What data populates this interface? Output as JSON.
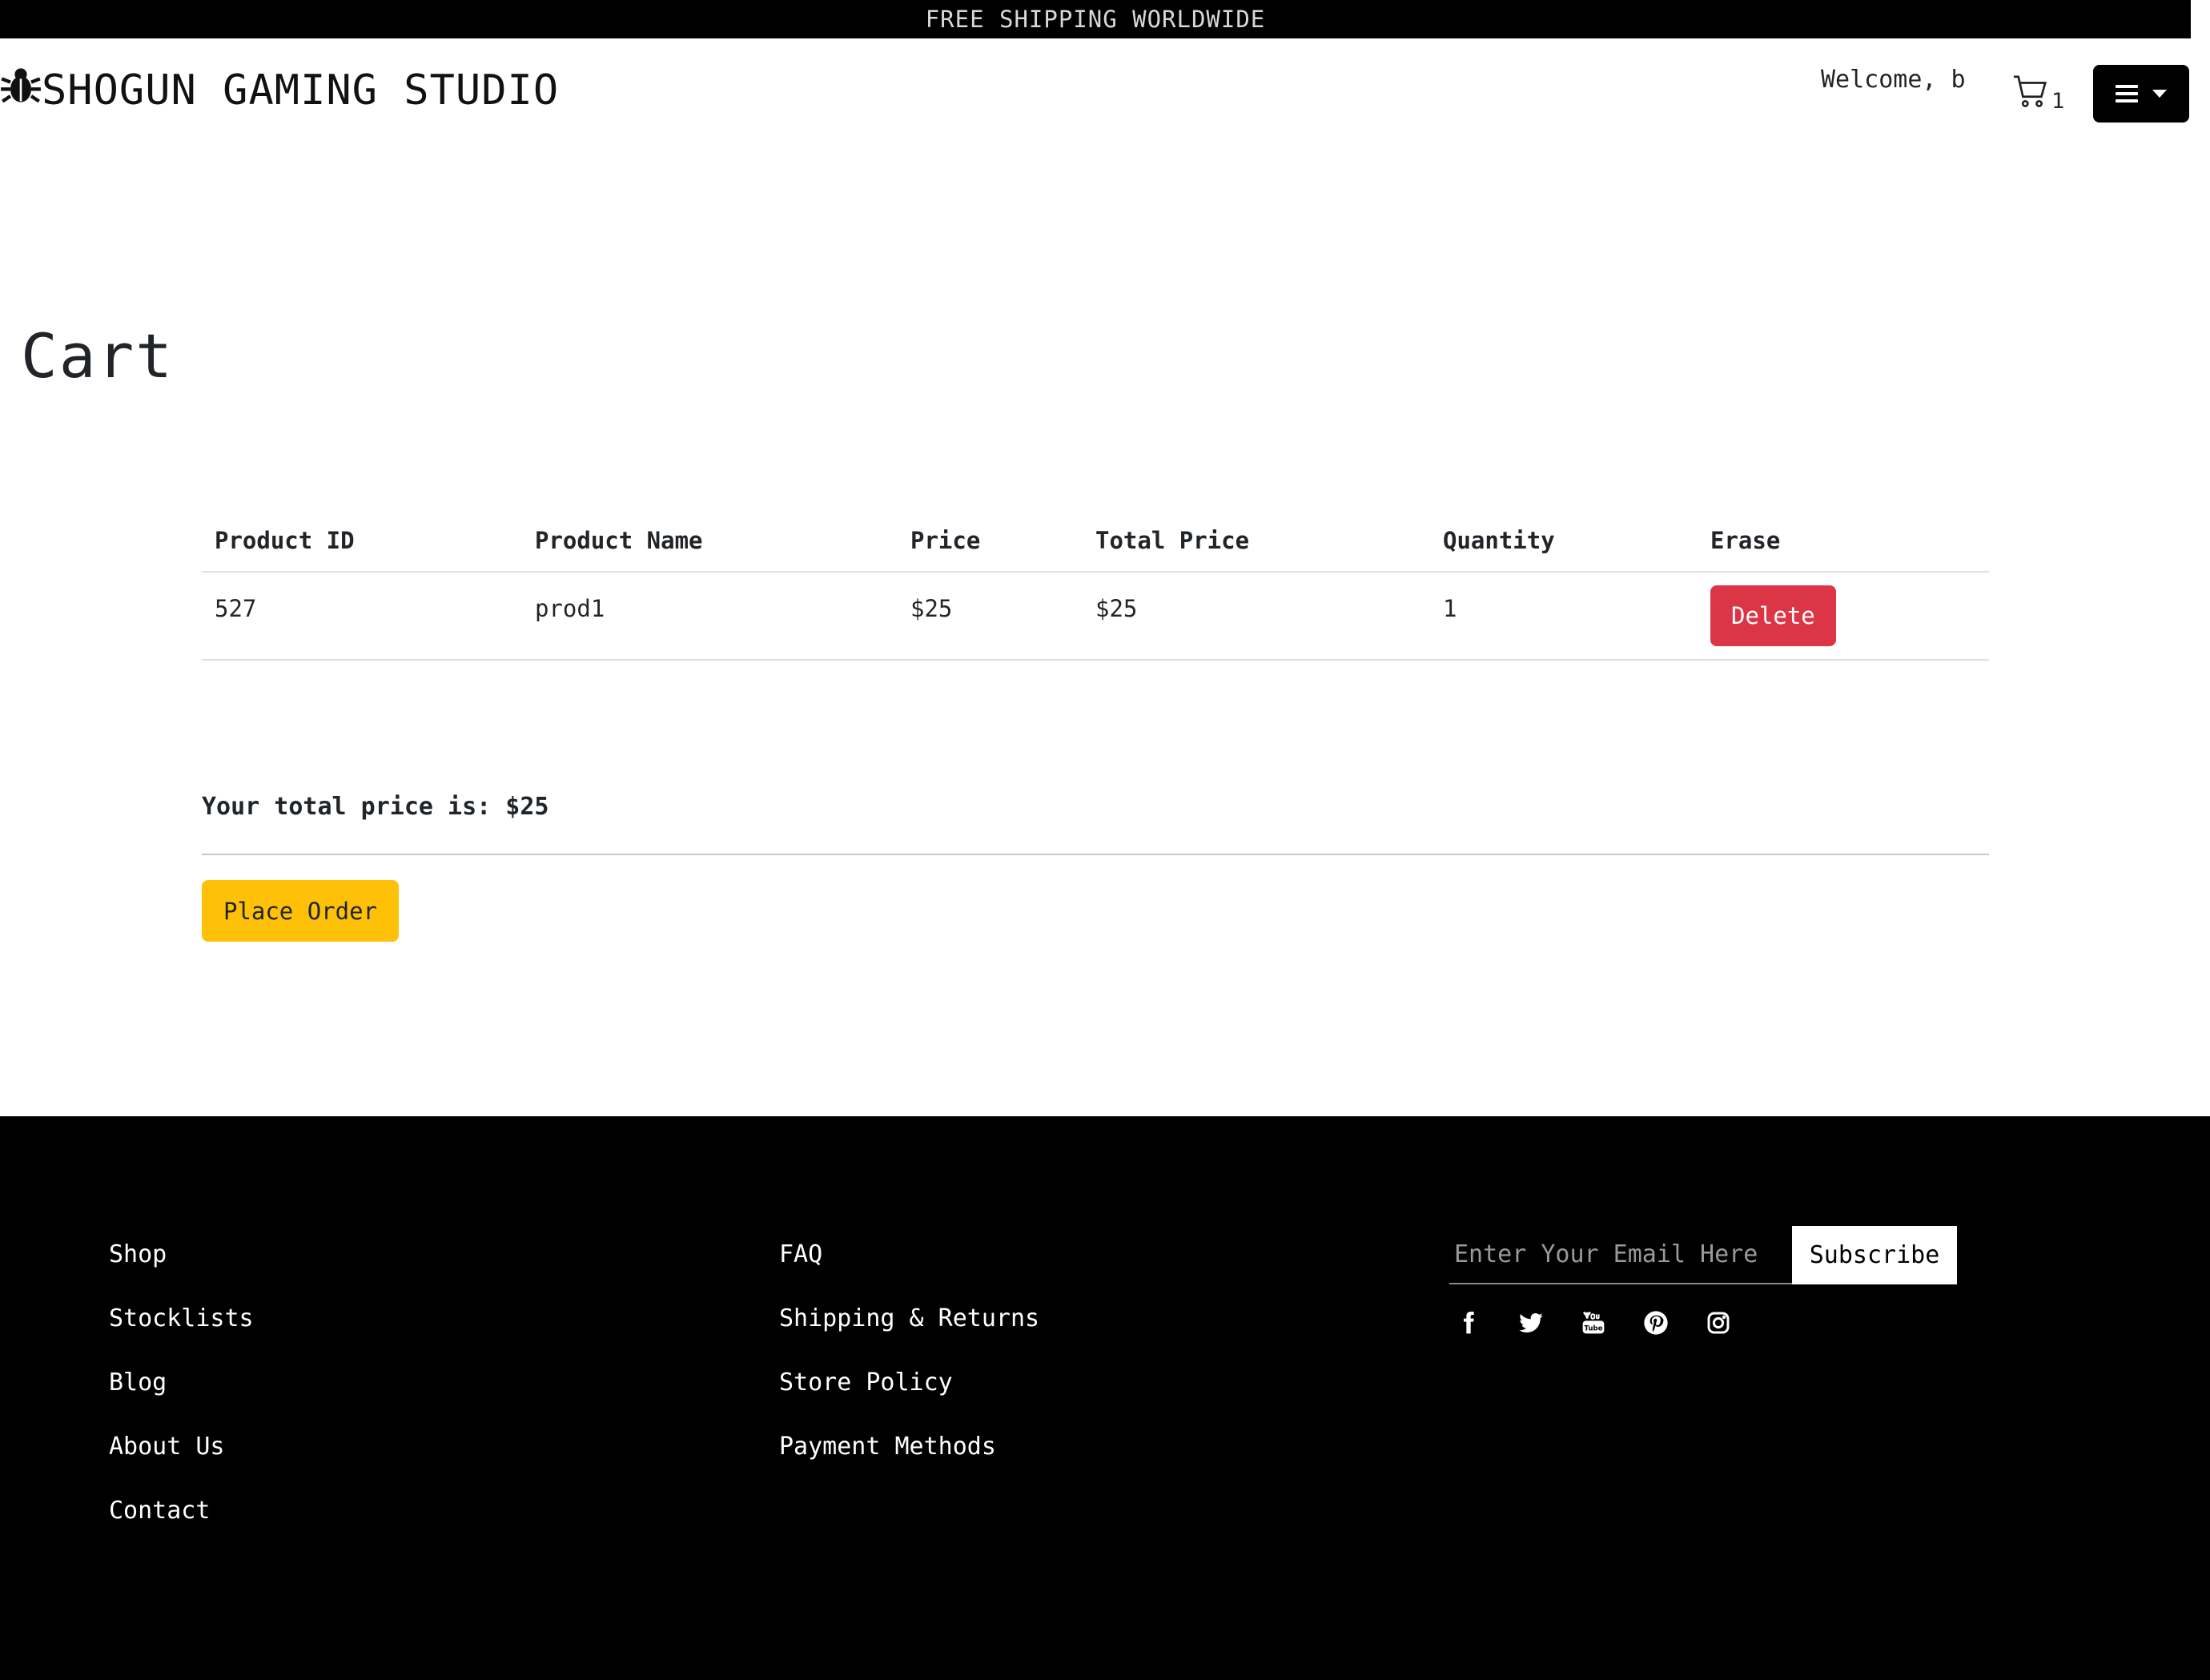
{
  "promo": {
    "text": "FREE SHIPPING WORLDWIDE"
  },
  "header": {
    "brand": "SHOGUN GAMING STUDIO",
    "brand_icon": "bug-icon",
    "welcome": "Welcome, b",
    "cart_icon": "cart-icon",
    "cart_count": "1",
    "menu_icon": "bars-icon"
  },
  "page": {
    "title": "Cart"
  },
  "cart": {
    "columns": [
      "Product ID",
      "Product Name",
      "Price",
      "Total Price",
      "Quantity",
      "Erase"
    ],
    "rows": [
      {
        "id": "527",
        "name": "prod1",
        "price": "$25",
        "total": "$25",
        "quantity": "1",
        "action": "Delete"
      }
    ],
    "total_text": "Your total price is: $25",
    "place_order": "Place Order"
  },
  "footer": {
    "links_left": [
      "Shop",
      "Stocklists",
      "Blog",
      "About Us",
      "Contact"
    ],
    "links_right": [
      "FAQ",
      "Shipping & Returns",
      "Store Policy",
      "Payment Methods"
    ],
    "email_placeholder": "Enter Your Email Here",
    "subscribe": "Subscribe",
    "socials": [
      "facebook-icon",
      "twitter-icon",
      "youtube-icon",
      "pinterest-icon",
      "instagram-icon"
    ]
  },
  "colors": {
    "delete": "#dc3545",
    "place_order": "#ffc107",
    "footer_bg": "#000000"
  }
}
